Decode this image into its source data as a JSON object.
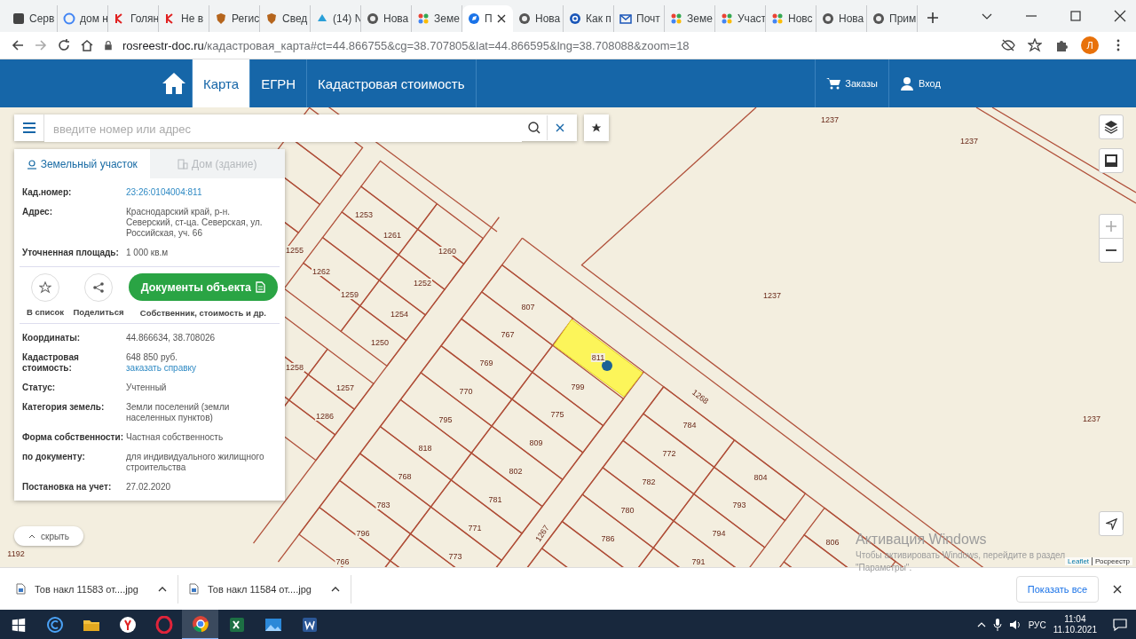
{
  "browser": {
    "tabs": [
      {
        "title": "Серв",
        "kind": "square",
        "selected": false
      },
      {
        "title": "дом н",
        "kind": "google",
        "selected": false
      },
      {
        "title": "Голян",
        "kind": "red",
        "selected": false
      },
      {
        "title": "Не в",
        "kind": "red",
        "selected": false
      },
      {
        "title": "Регис",
        "kind": "crest",
        "selected": false
      },
      {
        "title": "Свед",
        "kind": "crest",
        "selected": false
      },
      {
        "title": "(14) N",
        "kind": "cloud",
        "selected": false
      },
      {
        "title": "Нова",
        "kind": "globe",
        "selected": false
      },
      {
        "title": "Земе",
        "kind": "dots",
        "selected": false
      },
      {
        "title": "П",
        "kind": "compass",
        "selected": true
      },
      {
        "title": "Нова",
        "kind": "globe",
        "selected": false
      },
      {
        "title": "Как п",
        "kind": "at",
        "selected": false
      },
      {
        "title": "Почт",
        "kind": "mail",
        "selected": false
      },
      {
        "title": "Земе",
        "kind": "dots",
        "selected": false
      },
      {
        "title": "Участ",
        "kind": "dots",
        "selected": false
      },
      {
        "title": "Новс",
        "kind": "dots",
        "selected": false
      },
      {
        "title": "Нова",
        "kind": "globe",
        "selected": false
      },
      {
        "title": "Прим",
        "kind": "globe",
        "selected": false
      }
    ],
    "address": {
      "host": "rosreestr-doc.ru",
      "path": "/кадастровая_карта#ct=44.866755&cg=38.707805&lat=44.866595&lng=38.708088&zoom=18"
    },
    "profile": "Л"
  },
  "site": {
    "nav": [
      {
        "label": "Карта",
        "selected": true
      },
      {
        "label": "ЕГРН",
        "selected": false
      },
      {
        "label": "Кадастровая стоимость",
        "selected": false
      }
    ],
    "links": [
      {
        "label": "Заказы",
        "kind": "cart"
      },
      {
        "label": "Вход",
        "kind": "user"
      }
    ]
  },
  "search": {
    "placeholder": "введите номер или адрес"
  },
  "panel": {
    "tabs": [
      {
        "label": "Земельный участок",
        "selected": true
      },
      {
        "label": "Дом (здание)",
        "selected": false
      }
    ],
    "rows_top": [
      {
        "label": "Кад.номер:",
        "value": "23:26:0104004:811",
        "kind": "link"
      },
      {
        "label": "Адрес:",
        "value": "Краснодарский край, р-н. Северский, ст-ца. Северская, ул. Российская, уч. 66",
        "kind": "text"
      },
      {
        "label": "Уточненная площадь:",
        "value": "1 000 кв.м",
        "kind": "text"
      }
    ],
    "favorite_label": "В список",
    "share_label": "Поделиться",
    "documents_button": "Документы объекта",
    "documents_caption": "Собственник, стоимость и др.",
    "rows_bottom": [
      {
        "label": "Координаты:",
        "value": "44.866634, 38.708026",
        "kind": "text"
      },
      {
        "label": "Кадастровая стоимость:",
        "value": "648 850 руб.",
        "link": "заказать справку",
        "kind": "text"
      },
      {
        "label": "Статус:",
        "value": "Учтенный",
        "kind": "text"
      },
      {
        "label": "Категория земель:",
        "value": "Земли поселений (земли населенных пунктов)",
        "kind": "text"
      },
      {
        "label": "Форма собственности:",
        "value": "Частная собственность",
        "kind": "text"
      },
      {
        "label": "по документу:",
        "value": "для индивидуального жилищного строительства",
        "kind": "text"
      },
      {
        "label": "Постановка на учет:",
        "value": "27.02.2020",
        "kind": "text"
      }
    ]
  },
  "hide_button": "скрыть",
  "map": {
    "labels": [
      "1237",
      "1237",
      "1253",
      "1261",
      "1255",
      "1260",
      "1262",
      "1252",
      "1259",
      "1237",
      "807",
      "1254",
      "767",
      "1250",
      "811",
      "1258",
      "769",
      "1257",
      "770",
      "799",
      "1268",
      "1286",
      "795",
      "775",
      "784",
      "1237",
      "818",
      "809",
      "772",
      "768",
      "802",
      "782",
      "804",
      "783",
      "781",
      "780",
      "793",
      "796",
      "771",
      "1267",
      "786",
      "794",
      "806",
      "1192",
      "766",
      "773",
      "791"
    ],
    "attribution_link": "Leaflet",
    "attribution": "Росреестр"
  },
  "windows_activation": {
    "title": "Активация Windows",
    "line1": "Чтобы активировать Windows, перейдите в раздел",
    "line2": "\"Параметры\"."
  },
  "downloads": {
    "items": [
      {
        "name": "Тов накл 11583 от....jpg"
      },
      {
        "name": "Тов накл 11584 от....jpg"
      }
    ],
    "show_all": "Показать все"
  },
  "taskbar": {
    "apps": [
      {
        "kind": "cortana",
        "active": false
      },
      {
        "kind": "folder",
        "active": false
      },
      {
        "kind": "yandex",
        "active": false
      },
      {
        "kind": "opera",
        "active": false
      },
      {
        "kind": "chrome",
        "active": true
      },
      {
        "kind": "excel",
        "active": false
      },
      {
        "kind": "photos",
        "active": false
      },
      {
        "kind": "word",
        "active": false
      }
    ],
    "language": "РУС",
    "time": "11:04",
    "date": "11.10.2021"
  }
}
